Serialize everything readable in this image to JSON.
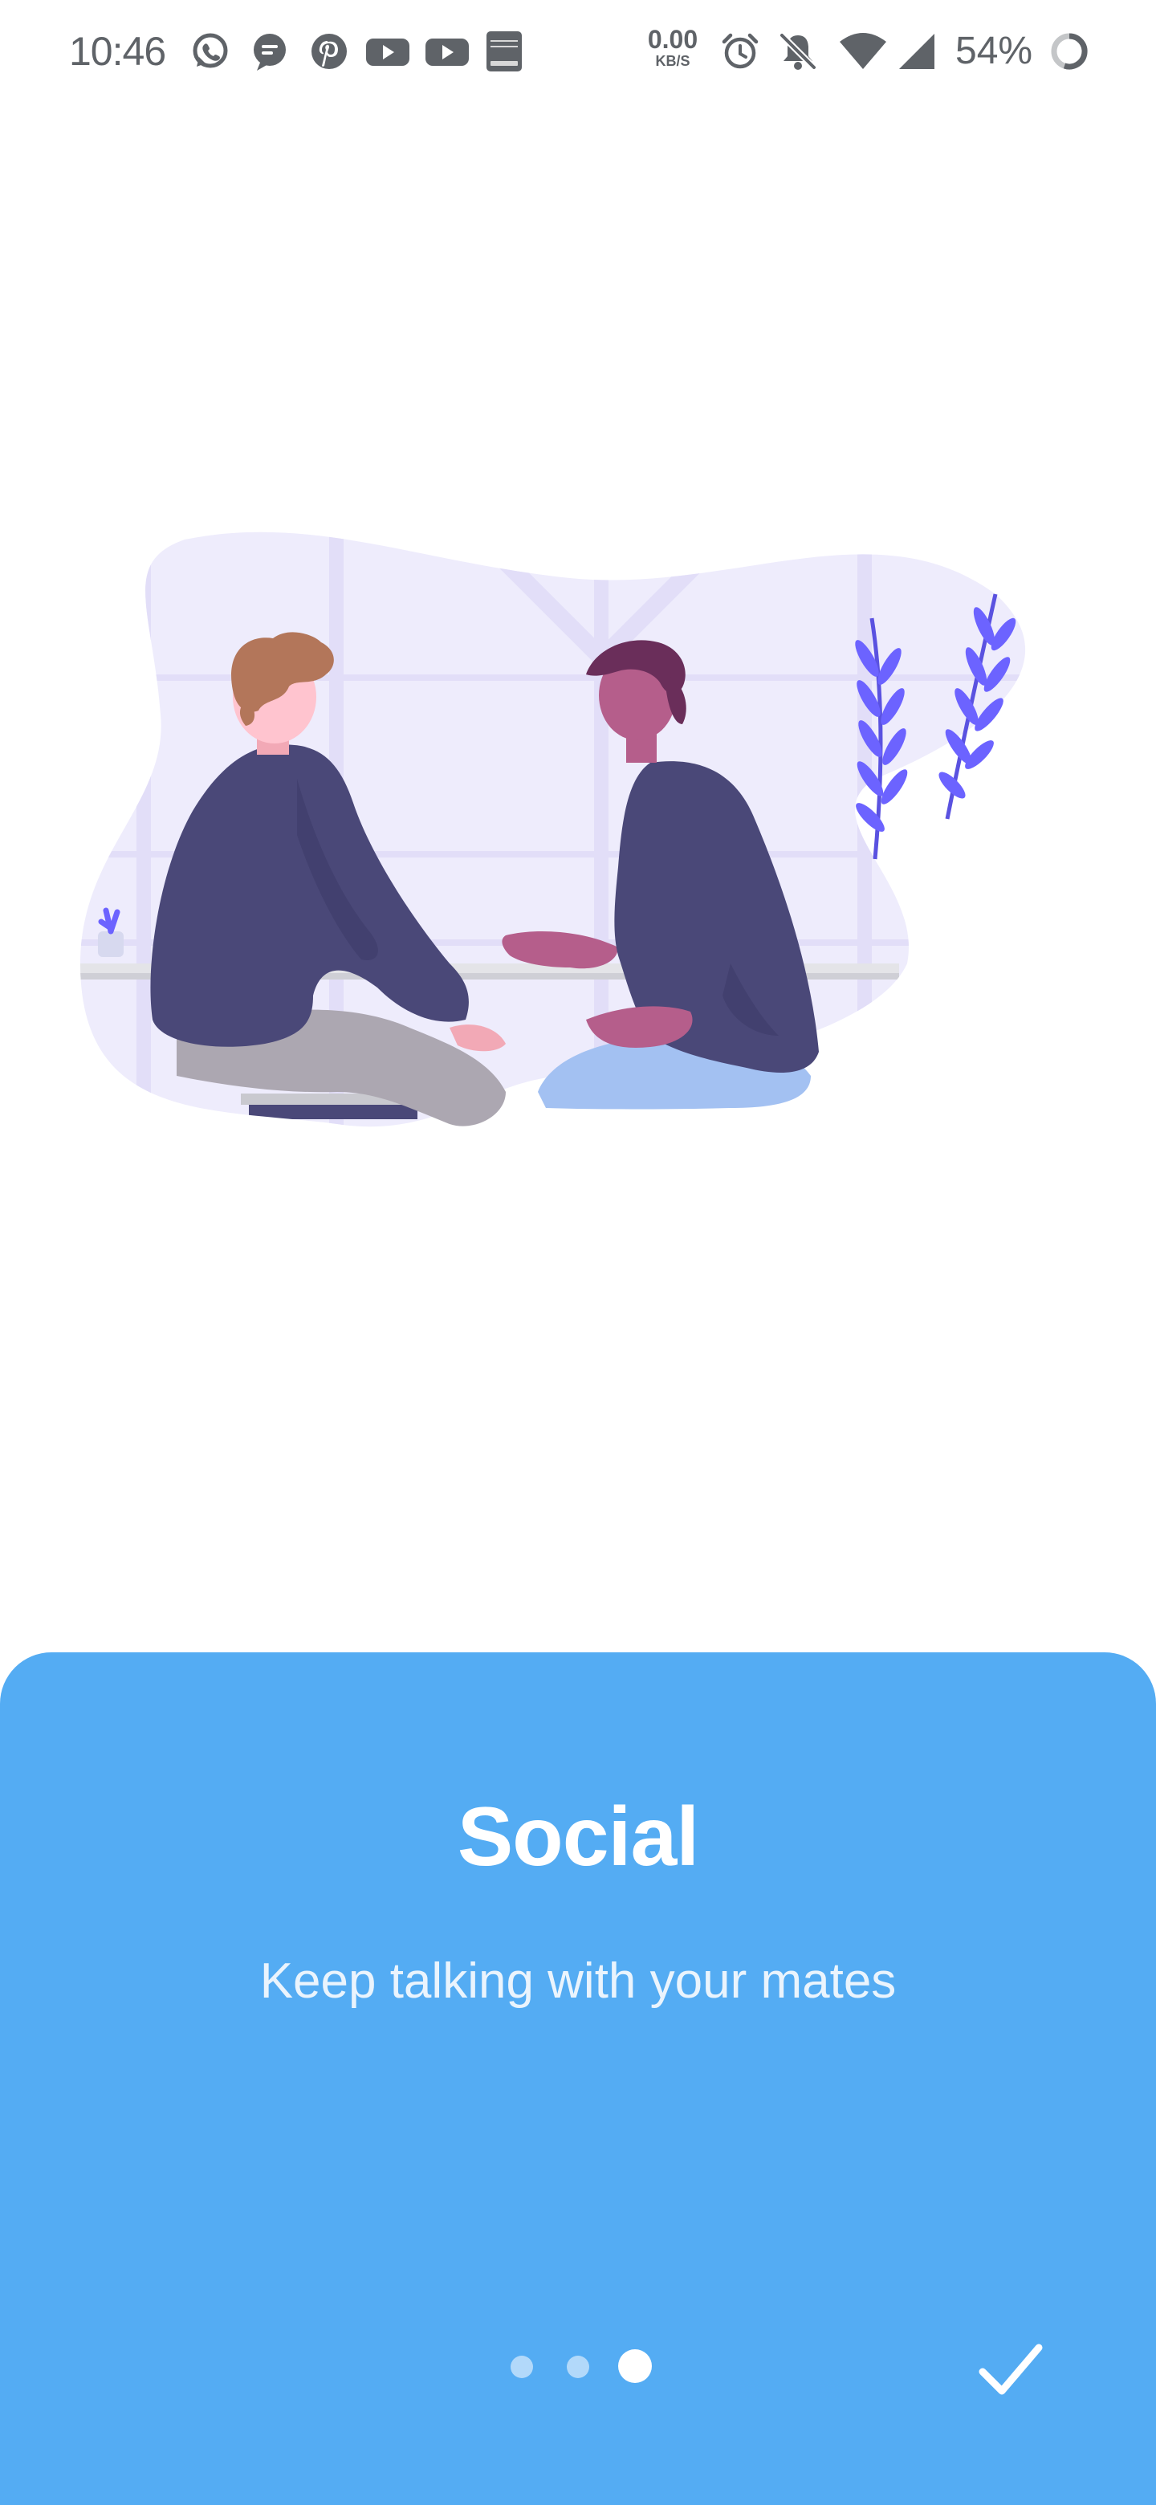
{
  "status_bar": {
    "time": "10:46",
    "net_speed_value": "0.00",
    "net_speed_unit": "KB/S",
    "battery_percent": "54%",
    "icons": [
      "whatsapp-icon",
      "messages-icon",
      "pinterest-icon",
      "youtube-icon",
      "youtube-icon",
      "bible-app-icon",
      "alarm-icon",
      "bell-off-icon",
      "wifi-icon",
      "signal-icon",
      "battery-ring-icon"
    ],
    "color": "#5f6368"
  },
  "onboarding": {
    "title": "Social",
    "subtitle": "Keep talking with your mates",
    "page_count": 3,
    "current_page": 3,
    "done_icon": "check-icon"
  },
  "colors": {
    "card_background": "#54acf3",
    "illustration_background": "#eeecfc",
    "accent_purple": "#6c63ff",
    "shirt_navy": "#4a4878"
  }
}
